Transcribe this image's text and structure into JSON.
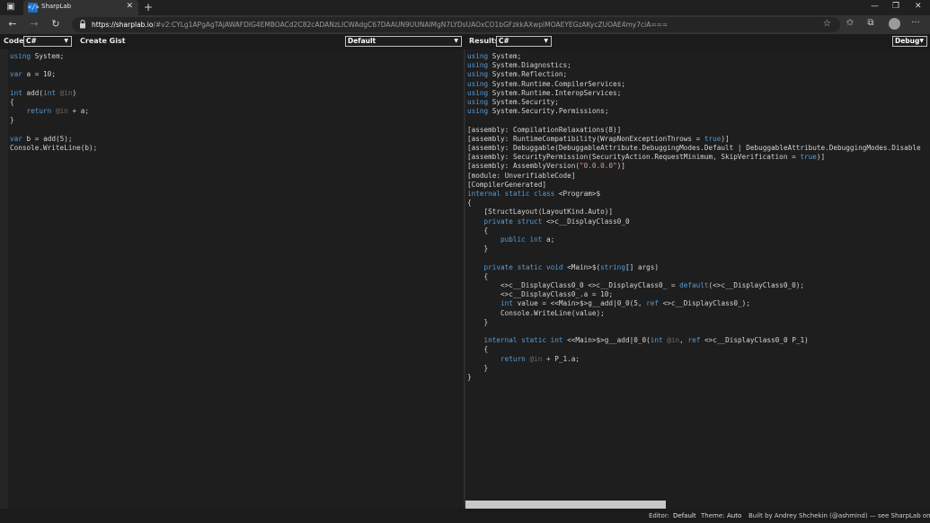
{
  "browser": {
    "tab_title": "SharpLab",
    "favicon_text": "</>",
    "new_tab": "+",
    "url_host": "https://sharplab.io",
    "url_rest": "/#v2:CYLg1APgAgTAjAWAFDIG4EMBOACd2C82cADANzLICWAdgC67DAAUN9UUNAlMgN7LYDsUAOxCO1bGFzkkAXwpIMOAEYEGzAKycZUOAE4my7ciA==="
  },
  "toolbar": {
    "code_label": "Code",
    "code_language": "C#",
    "create_gist": "Create Gist",
    "branch": "Default",
    "results_label": "Results",
    "results_language": "C#",
    "mode": "Debug"
  },
  "code_lines": [
    "using System;",
    "",
    "var a = 10;",
    "",
    "int add(int @in)",
    "{",
    "    return @in + a;",
    "}",
    "",
    "var b = add(5);",
    "Console.WriteLine(b);"
  ],
  "results_lines": [
    "using System;",
    "using System.Diagnostics;",
    "using System.Reflection;",
    "using System.Runtime.CompilerServices;",
    "using System.Runtime.InteropServices;",
    "using System.Security;",
    "using System.Security.Permissions;",
    "",
    "[assembly: CompilationRelaxations(8)]",
    "[assembly: RuntimeCompatibility(WrapNonExceptionThrows = true)]",
    "[assembly: Debuggable(DebuggableAttribute.DebuggingModes.Default | DebuggableAttribute.DebuggingModes.Disable",
    "[assembly: SecurityPermission(SecurityAction.RequestMinimum, SkipVerification = true)]",
    "[assembly: AssemblyVersion(\"0.0.0.0\")]",
    "[module: UnverifiableCode]",
    "[CompilerGenerated]",
    "internal static class <Program>$",
    "{",
    "    [StructLayout(LayoutKind.Auto)]",
    "    private struct <>c__DisplayClass0_0",
    "    {",
    "        public int a;",
    "    }",
    "",
    "    private static void <Main>$(string[] args)",
    "    {",
    "        <>c__DisplayClass0_0 <>c__DisplayClass0_ = default(<>c__DisplayClass0_0);",
    "        <>c__DisplayClass0_.a = 10;",
    "        int value = <<Main>$>g__add|0_0(5, ref <>c__DisplayClass0_);",
    "        Console.WriteLine(value);",
    "    }",
    "",
    "    internal static int <<Main>$>g__add|0_0(int @in, ref <>c__DisplayClass0_0 P_1)",
    "    {",
    "        return @in + P_1.a;",
    "    }",
    "}"
  ],
  "footer": {
    "editor_label": "Editor:",
    "editor_value": "Default",
    "theme_label": "Theme:",
    "theme_value": "Auto",
    "built_by": "Built by Andrey Shchekin (@ashmind) — see SharpLab on GitHub."
  },
  "icons": {
    "back": "back-arrow-icon",
    "forward": "forward-arrow-icon",
    "reload": "reload-icon",
    "lock": "lock-icon",
    "favorite": "star-icon",
    "favorites": "favorites-icon",
    "collections": "collections-icon",
    "profile": "profile-icon",
    "more": "more-icon"
  },
  "colors": {
    "keyword": "#569cd6",
    "string": "#d69d85",
    "parameter_dim": "#6a6a6a",
    "background": "#1e1e1e"
  }
}
